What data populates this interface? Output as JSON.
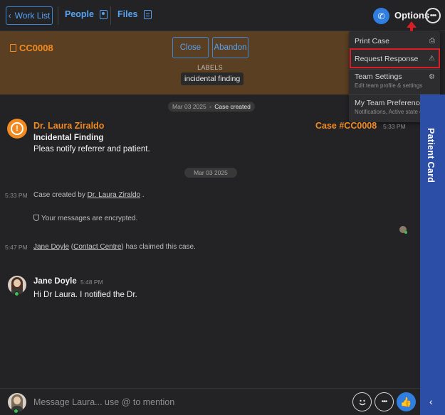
{
  "header": {
    "back_label": "Work List",
    "people_label": "People",
    "files_label": "Files",
    "options_label": "Options"
  },
  "case": {
    "id": "CC0008",
    "close_label": "Close",
    "abandon_label": "Abandon",
    "labels_title": "LABELS",
    "labels": [
      "incidental finding"
    ]
  },
  "options_menu": {
    "items": [
      {
        "title": "Print Case",
        "subtitle": "",
        "icon": "printer-icon"
      },
      {
        "title": "Request Response",
        "subtitle": "",
        "icon": "warning-icon"
      },
      {
        "title": "Team Settings",
        "subtitle": "Edit team profile & settings",
        "icon": "gear-icon"
      },
      {
        "title": "My Team Preferences",
        "subtitle": "Notifications, Active state etc.",
        "icon": "gear-icon"
      }
    ]
  },
  "side_panel": {
    "label": "Patient Card"
  },
  "timeline": {
    "created_pill": {
      "date": "Mar 03 2025",
      "event": "Case created"
    },
    "first_message": {
      "sender": "Dr. Laura Ziraldo",
      "case_ref": "Case #CC0008",
      "time": "5:33 PM",
      "title": "Incidental Finding",
      "body": "Pleas notify referrer and patient."
    },
    "date_pill": "Mar 03 2025",
    "system_created": {
      "time": "5:33 PM",
      "prefix": "Case created by",
      "user": "Dr. Laura Ziraldo",
      "suffix": "."
    },
    "encrypted_note": "Your messages are encrypted.",
    "system_claimed": {
      "time": "5:47 PM",
      "user": "Jane Doyle",
      "org": "Contact Centre",
      "suffix": "has claimed this case."
    },
    "reply": {
      "sender": "Jane Doyle",
      "time": "5:48 PM",
      "body": "Hi Dr Laura. I notified the Dr."
    }
  },
  "composer": {
    "placeholder": "Message Laura... use @ to mention"
  },
  "colors": {
    "accent_blue": "#57a3f2",
    "case_orange": "#f08a21",
    "banner_brown": "#5a3f22",
    "rail_blue": "#2c4ea6",
    "highlight_red": "#d81e24"
  }
}
